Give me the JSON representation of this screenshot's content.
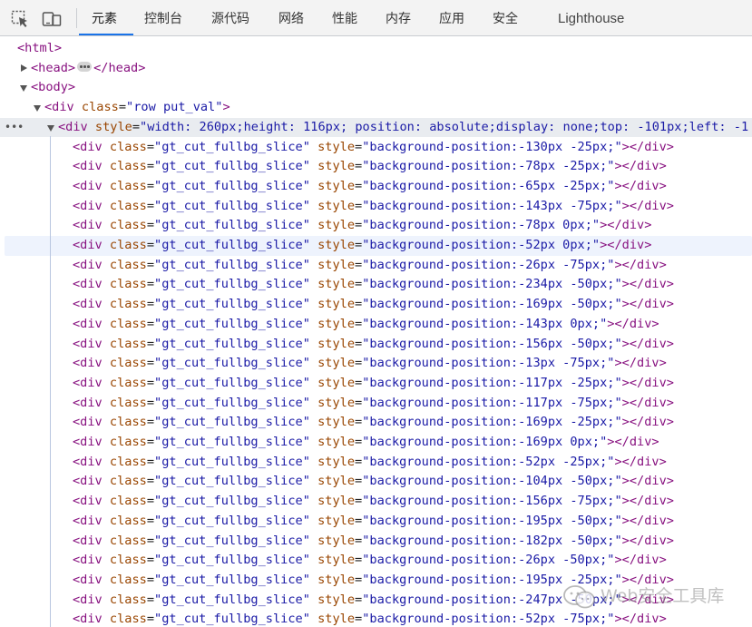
{
  "toolbar": {
    "inspect_icon": "inspect-element-icon",
    "device_icon": "device-toolbar-icon"
  },
  "tabs": [
    {
      "label": "元素",
      "active": true
    },
    {
      "label": "控制台"
    },
    {
      "label": "源代码"
    },
    {
      "label": "网络"
    },
    {
      "label": "性能"
    },
    {
      "label": "内存"
    },
    {
      "label": "应用"
    },
    {
      "label": "安全"
    },
    {
      "label": "Lighthouse"
    }
  ],
  "tree": {
    "html_open": "<html>",
    "head": {
      "open": "<head>",
      "close": "</head>"
    },
    "body_open": "<body>",
    "div_row": {
      "tag": "<div ",
      "attr": "class",
      "eq": "=",
      "value": "\"row put_val\"",
      "end": ">"
    },
    "div_style": {
      "tag": "<div ",
      "attr": "style",
      "eq": "=",
      "value": "\"width: 260px;height: 116px; position: absolute;display: none;top: -101px;left: -1"
    },
    "slice_class": "\"gt_cut_fullbg_slice\"",
    "slices": [
      "-130px -25px;",
      "-78px -25px;",
      "-65px -25px;",
      "-143px -75px;",
      "-78px 0px;",
      "-52px 0px;",
      "-26px -75px;",
      "-234px -50px;",
      "-169px -50px;",
      "-143px 0px;",
      "-156px -50px;",
      "-13px -75px;",
      "-117px -25px;",
      "-117px -75px;",
      "-169px -25px;",
      "-169px 0px;",
      "-52px -25px;",
      "-104px -50px;",
      "-156px -75px;",
      "-195px -50px;",
      "-182px -50px;",
      "-26px -50px;",
      "-195px -25px;",
      "-247px -50px;",
      "-52px -75px;"
    ]
  },
  "watermark": {
    "text": "Web安全工具库",
    "icon": "wechat-icon"
  }
}
